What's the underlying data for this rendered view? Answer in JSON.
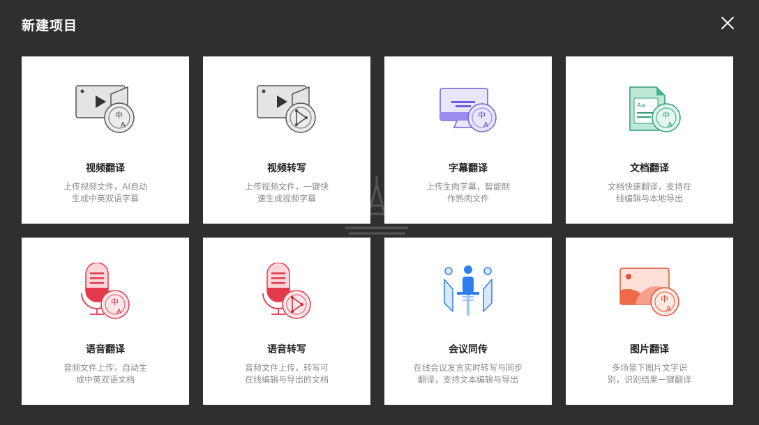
{
  "modal": {
    "title": "新建项目",
    "close_icon": "close-icon"
  },
  "colors": {
    "background": "#2f2f2f",
    "card": "#ffffff",
    "title_text": "#222222",
    "desc_text": "#8a8a8a",
    "video_gray": "#dcdcdc",
    "subtitle_purple": "#9b8af0",
    "doc_green": "#3fb58a",
    "audio_red": "#e23a4b",
    "meeting_blue": "#2e7ef0",
    "image_orange": "#f06a4a"
  },
  "cards": [
    {
      "icon": "video-translate-icon",
      "title": "视频翻译",
      "desc": [
        "上传视频文件，AI自动",
        "生成中英双语字幕"
      ]
    },
    {
      "icon": "video-transcribe-icon",
      "title": "视频转写",
      "desc": [
        "上传视频文件，一键快",
        "速生成视频字幕"
      ]
    },
    {
      "icon": "subtitle-translate-icon",
      "title": "字幕翻译",
      "desc": [
        "上传生肉字幕，智能制",
        "作熟肉文件"
      ]
    },
    {
      "icon": "document-translate-icon",
      "title": "文档翻译",
      "desc": [
        "文档快速翻译，支持在",
        "线编辑与本地导出"
      ]
    },
    {
      "icon": "audio-translate-icon",
      "title": "语音翻译",
      "desc": [
        "音频文件上传，自动生",
        "成中英双语文档"
      ]
    },
    {
      "icon": "audio-transcribe-icon",
      "title": "语音转写",
      "desc": [
        "音频文件上传，转写可",
        "在线编辑与导出的文档"
      ]
    },
    {
      "icon": "meeting-interpret-icon",
      "title": "会议同传",
      "desc": [
        "在线会议发言实时转写与同步",
        "翻译，支持文本编辑与导出"
      ]
    },
    {
      "icon": "image-translate-icon",
      "title": "图片翻译",
      "desc": [
        "多场景下图片文字识",
        "别，识别结果一键翻译"
      ]
    }
  ]
}
